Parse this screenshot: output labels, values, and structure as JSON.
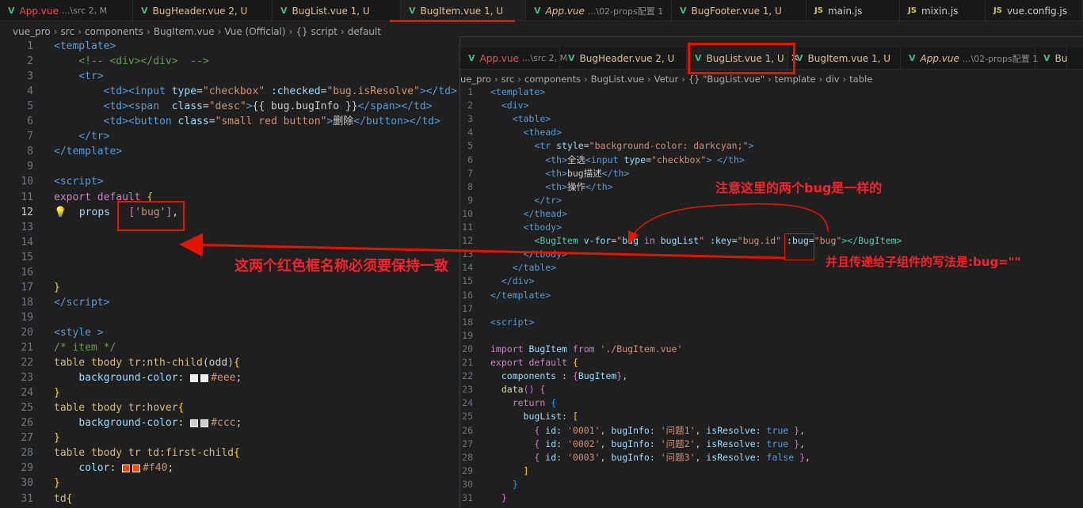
{
  "left_tabs": [
    {
      "name": "App.vue",
      "sub": "...\\src 2, M",
      "icon": "vue-icon",
      "style": "red"
    },
    {
      "name": "BugHeader.vue 2, U",
      "sub": "",
      "icon": "vue-icon",
      "style": ""
    },
    {
      "name": "BugList.vue 1, U",
      "sub": "",
      "icon": "vue-icon",
      "style": ""
    },
    {
      "name": "BugItem.vue 1, U",
      "sub": "",
      "icon": "vue-icon",
      "style": "active"
    },
    {
      "name": "App.vue",
      "sub": "...\\02-props配置 1",
      "icon": "vue-icon",
      "style": "ital"
    },
    {
      "name": "BugFooter.vue 1, U",
      "sub": "",
      "icon": "vue-icon",
      "style": ""
    },
    {
      "name": "main.js",
      "sub": "",
      "icon": "js-icon",
      "style": "js"
    },
    {
      "name": "mixin.js",
      "sub": "",
      "icon": "js-icon",
      "style": "js"
    },
    {
      "name": "vue.config.js",
      "sub": "",
      "icon": "js-icon",
      "style": "js"
    }
  ],
  "left_breadcrumb": [
    "vue_pro",
    "src",
    "components",
    "BugItem.vue",
    "Vue (Official)",
    "{} script",
    "default"
  ],
  "right_tabs": [
    {
      "name": "App.vue",
      "sub": "...\\src 2, M",
      "icon": "vue-icon",
      "style": "red"
    },
    {
      "name": "BugHeader.vue 2, U",
      "sub": "",
      "icon": "vue-icon",
      "style": ""
    },
    {
      "name": "BugList.vue 1, U",
      "sub": "",
      "icon": "vue-icon",
      "style": "active"
    },
    {
      "name": "BugItem.vue 1, U",
      "sub": "",
      "icon": "vue-icon",
      "style": ""
    },
    {
      "name": "App.vue",
      "sub": "...\\02-props配置 1",
      "icon": "vue-icon",
      "style": "ital"
    },
    {
      "name": "Bu",
      "sub": "",
      "icon": "vue-icon",
      "style": ""
    }
  ],
  "right_breadcrumb": [
    "ue_pro",
    "src",
    "components",
    "BugList.vue",
    "Vetur",
    "{} \"BugList.vue\"",
    "template",
    "div",
    "table"
  ],
  "left_code": [
    {
      "n": "1",
      "h": "<span class='t'>&lt;template&gt;</span>"
    },
    {
      "n": "2",
      "h": "    <span class='c'>&lt;!-- &lt;div&gt;&lt;/div&gt;  --&gt;</span>"
    },
    {
      "n": "3",
      "h": "    <span class='t'>&lt;tr&gt;</span>"
    },
    {
      "n": "4",
      "h": "        <span class='t'>&lt;td&gt;&lt;input</span> <span class='a'>type</span>=<span class='s'>\"checkbox\"</span> <span class='a'>:checked</span>=<span class='s'>\"bug.isResolve\"</span><span class='t'>&gt;&lt;/td&gt;</span>"
    },
    {
      "n": "5",
      "h": "        <span class='t'>&lt;td&gt;&lt;span</span>  <span class='a'>class</span>=<span class='s'>\"desc\"</span><span class='t'>&gt;</span><span class='p'>{{ bug.bugInfo }}</span><span class='t'>&lt;/span&gt;&lt;/td&gt;</span>"
    },
    {
      "n": "6",
      "h": "        <span class='t'>&lt;td&gt;&lt;button</span> <span class='a'>class</span>=<span class='s'>\"small red button\"</span><span class='t'>&gt;</span><span class='p'>删除</span><span class='t'>&lt;/button&gt;&lt;/td&gt;</span>"
    },
    {
      "n": "7",
      "h": "    <span class='t'>&lt;/tr&gt;</span>"
    },
    {
      "n": "8",
      "h": "<span class='t'>&lt;/template&gt;</span>"
    },
    {
      "n": "9",
      "h": ""
    },
    {
      "n": "10",
      "h": "<span class='t'>&lt;script&gt;</span>"
    },
    {
      "n": "11",
      "h": "<span class='k'>export default</span> <span class='br'>{</span>"
    },
    {
      "n": "12",
      "h": "<span class='bulb'>💡</span>  <span class='a'>props</span>   <span class='br2'>[</span><span class='s'>'bug'</span><span class='br2'>]</span>,",
      "cur": true
    },
    {
      "n": "13",
      "h": ""
    },
    {
      "n": "14",
      "h": ""
    },
    {
      "n": "15",
      "h": ""
    },
    {
      "n": "16",
      "h": ""
    },
    {
      "n": "17",
      "h": "<span class='br'>}</span>"
    },
    {
      "n": "18",
      "h": "<span class='t'>&lt;/script&gt;</span>"
    },
    {
      "n": "19",
      "h": ""
    },
    {
      "n": "20",
      "h": "<span class='t'>&lt;style</span> <span class='t'>&gt;</span>"
    },
    {
      "n": "21",
      "h": "<span class='c'>/* item */</span>"
    },
    {
      "n": "22",
      "h": "<span class='y'>table tbody tr:nth-child</span><span class='p'>(odd)</span><span class='br'>{</span>"
    },
    {
      "n": "23",
      "h": "    <span class='a'>background-color</span>: <i class='sw' style='background:#eee'></i><i class='sw' style='background:#eee'></i><span class='s'>#eee</span>;"
    },
    {
      "n": "24",
      "h": "<span class='br'>}</span>"
    },
    {
      "n": "25",
      "h": "<span class='y'>table tbody tr:hover</span><span class='br'>{</span>"
    },
    {
      "n": "26",
      "h": "    <span class='a'>background-color</span>: <i class='sw' style='background:#ccc'></i><i class='sw' style='background:#ccc'></i><span class='s'>#ccc</span>;"
    },
    {
      "n": "27",
      "h": "<span class='br'>}</span>"
    },
    {
      "n": "28",
      "h": "<span class='y'>table tbody tr td:first-child</span><span class='br'>{</span>"
    },
    {
      "n": "29",
      "h": "    <span class='a'>color</span>: <i class='sw' style='background:#f40'></i><i class='sw' style='background:#f40'></i><span class='s'>#f40</span>;"
    },
    {
      "n": "30",
      "h": "<span class='br'>}</span>"
    },
    {
      "n": "31",
      "h": "<span class='y'>td</span><span class='br'>{</span>"
    }
  ],
  "right_code": [
    {
      "n": "1",
      "h": "<span class='t'>&lt;template&gt;</span>"
    },
    {
      "n": "2",
      "h": "  <span class='t'>&lt;div&gt;</span>"
    },
    {
      "n": "3",
      "h": "    <span class='t'>&lt;table&gt;</span>"
    },
    {
      "n": "4",
      "h": "      <span class='t'>&lt;thead&gt;</span>"
    },
    {
      "n": "5",
      "h": "        <span class='t'>&lt;tr</span> <span class='a'>style</span>=<span class='s'>\"background-color: darkcyan;\"</span><span class='t'>&gt;</span>"
    },
    {
      "n": "6",
      "h": "          <span class='t'>&lt;th&gt;</span><span class='p'>全选</span><span class='t'>&lt;input</span> <span class='a'>type</span>=<span class='s'>\"checkbox\"</span><span class='t'>&gt; &lt;/th&gt;</span>"
    },
    {
      "n": "7",
      "h": "          <span class='t'>&lt;th&gt;</span><span class='p'>bug描述</span><span class='t'>&lt;/th&gt;</span>"
    },
    {
      "n": "8",
      "h": "          <span class='t'>&lt;th&gt;</span><span class='p'>操作</span><span class='t'>&lt;/th&gt;</span>"
    },
    {
      "n": "9",
      "h": "        <span class='t'>&lt;/tr&gt;</span>"
    },
    {
      "n": "10",
      "h": "      <span class='t'>&lt;/thead&gt;</span>"
    },
    {
      "n": "11",
      "h": "      <span class='t'>&lt;tbody&gt;</span>"
    },
    {
      "n": "12",
      "h": "        <span class='cls'>&lt;BugItem</span> <span class='a'>v-for</span>=<span class='s'>\"</span><span class='a'>bug</span> <span class='k'>in</span> <span class='a'>bugList</span><span class='s'>\"</span> <span class='a'>:key</span>=<span class='s'>\"bug.id\"</span> <span class='a'>:bug</span>=<span class='s'>\"bug\"</span><span class='cls'>&gt;&lt;/BugItem&gt;</span>"
    },
    {
      "n": "13",
      "h": "      <span class='t'>&lt;/tbody&gt;</span>"
    },
    {
      "n": "14",
      "h": "    <span class='t'>&lt;/table&gt;</span>"
    },
    {
      "n": "15",
      "h": "  <span class='t'>&lt;/div&gt;</span>"
    },
    {
      "n": "16",
      "h": "<span class='t'>&lt;/template&gt;</span>"
    },
    {
      "n": "17",
      "h": ""
    },
    {
      "n": "18",
      "h": "<span class='t'>&lt;script&gt;</span>"
    },
    {
      "n": "19",
      "h": ""
    },
    {
      "n": "20",
      "h": "<span class='k'>import</span> <span class='a'>BugItem</span> <span class='k'>from</span> <span class='s'>'./BugItem.vue'</span>"
    },
    {
      "n": "21",
      "h": "<span class='k'>export default</span> <span class='br'>{</span>"
    },
    {
      "n": "22",
      "h": "  <span class='a'>components</span> : <span class='br2'>{</span><span class='a'>BugItem</span><span class='br2'>}</span>,"
    },
    {
      "n": "23",
      "h": "  <span class='f'>data</span><span class='br2'>()</span> <span class='br2'>{</span>"
    },
    {
      "n": "24",
      "h": "    <span class='k'>return</span> <span class='br3'>{</span>"
    },
    {
      "n": "25",
      "h": "      <span class='a'>bugList</span>: <span class='br'>[</span>"
    },
    {
      "n": "26",
      "h": "        <span class='br2'>{</span> <span class='a'>id</span>: <span class='s'>'0001'</span>, <span class='a'>bugInfo</span>: <span class='s'>'问题1'</span>, <span class='a'>isResolve</span>: <span class='bool'>true</span> <span class='br2'>}</span>,"
    },
    {
      "n": "27",
      "h": "        <span class='br2'>{</span> <span class='a'>id</span>: <span class='s'>'0002'</span>, <span class='a'>bugInfo</span>: <span class='s'>'问题2'</span>, <span class='a'>isResolve</span>: <span class='bool'>true</span> <span class='br2'>}</span>,"
    },
    {
      "n": "28",
      "h": "        <span class='br2'>{</span> <span class='a'>id</span>: <span class='s'>'0003'</span>, <span class='a'>bugInfo</span>: <span class='s'>'问题3'</span>, <span class='a'>isResolve</span>: <span class='bool'>false</span> <span class='br2'>}</span>,"
    },
    {
      "n": "29",
      "h": "      <span class='br'>]</span>"
    },
    {
      "n": "30",
      "h": "    <span class='br3'>}</span>"
    },
    {
      "n": "31",
      "h": "  <span class='br2'>}</span>"
    }
  ],
  "annotations": {
    "same_bug_note": "注意这里的两个bug是一样的",
    "names_match_note": "这两个红色框名称必须要保持一致",
    "pass_prop_note": "并且传递给子组件的写法是:bug=\"\""
  },
  "colors": {
    "annotation": "#f5222d",
    "box": "#e51400",
    "active_underline": "#e51400"
  }
}
